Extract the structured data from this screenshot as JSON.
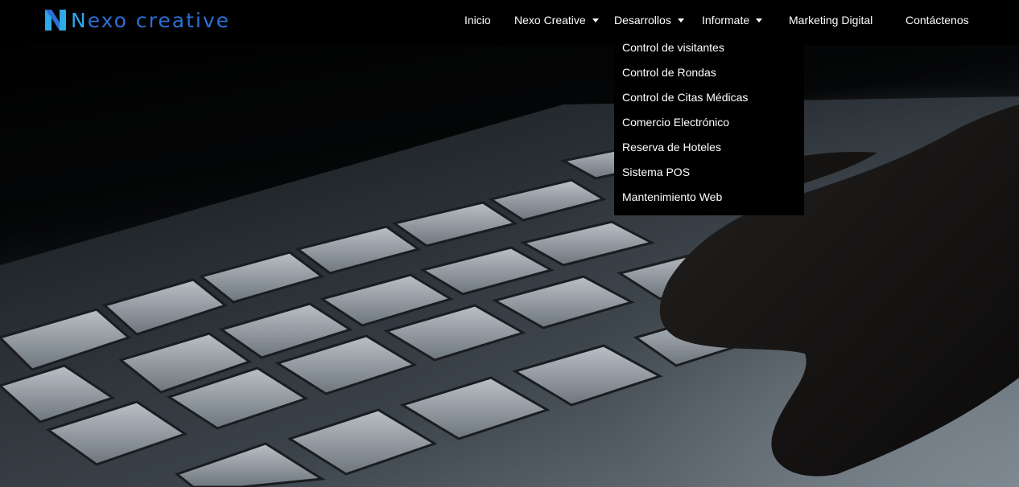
{
  "brand": {
    "logo_mark": "N-logo-icon",
    "name_first": "N",
    "name_rest": "exo creative"
  },
  "nav": {
    "items": [
      {
        "label": "Inicio"
      },
      {
        "label": "Nexo Creative",
        "has_dropdown": true
      },
      {
        "label": "Desarrollos",
        "has_dropdown": true,
        "open": true
      },
      {
        "label": "Informate",
        "has_dropdown": true
      },
      {
        "label": "Marketing Digital"
      },
      {
        "label": "Contáctenos"
      }
    ]
  },
  "dropdown": {
    "parent": "Desarrollos",
    "items": [
      {
        "label": "Control de visitantes"
      },
      {
        "label": "Control de Rondas"
      },
      {
        "label": "Control de Citas Médicas"
      },
      {
        "label": "Comercio Electrónico"
      },
      {
        "label": "Reserva de Hoteles"
      },
      {
        "label": "Sistema POS"
      },
      {
        "label": "Mantenimiento Web"
      }
    ]
  },
  "colors": {
    "nav_background": "#000000",
    "logo_primary": "#2b6fd6",
    "logo_accent": "#2fa8e8",
    "text": "#ffffff"
  }
}
